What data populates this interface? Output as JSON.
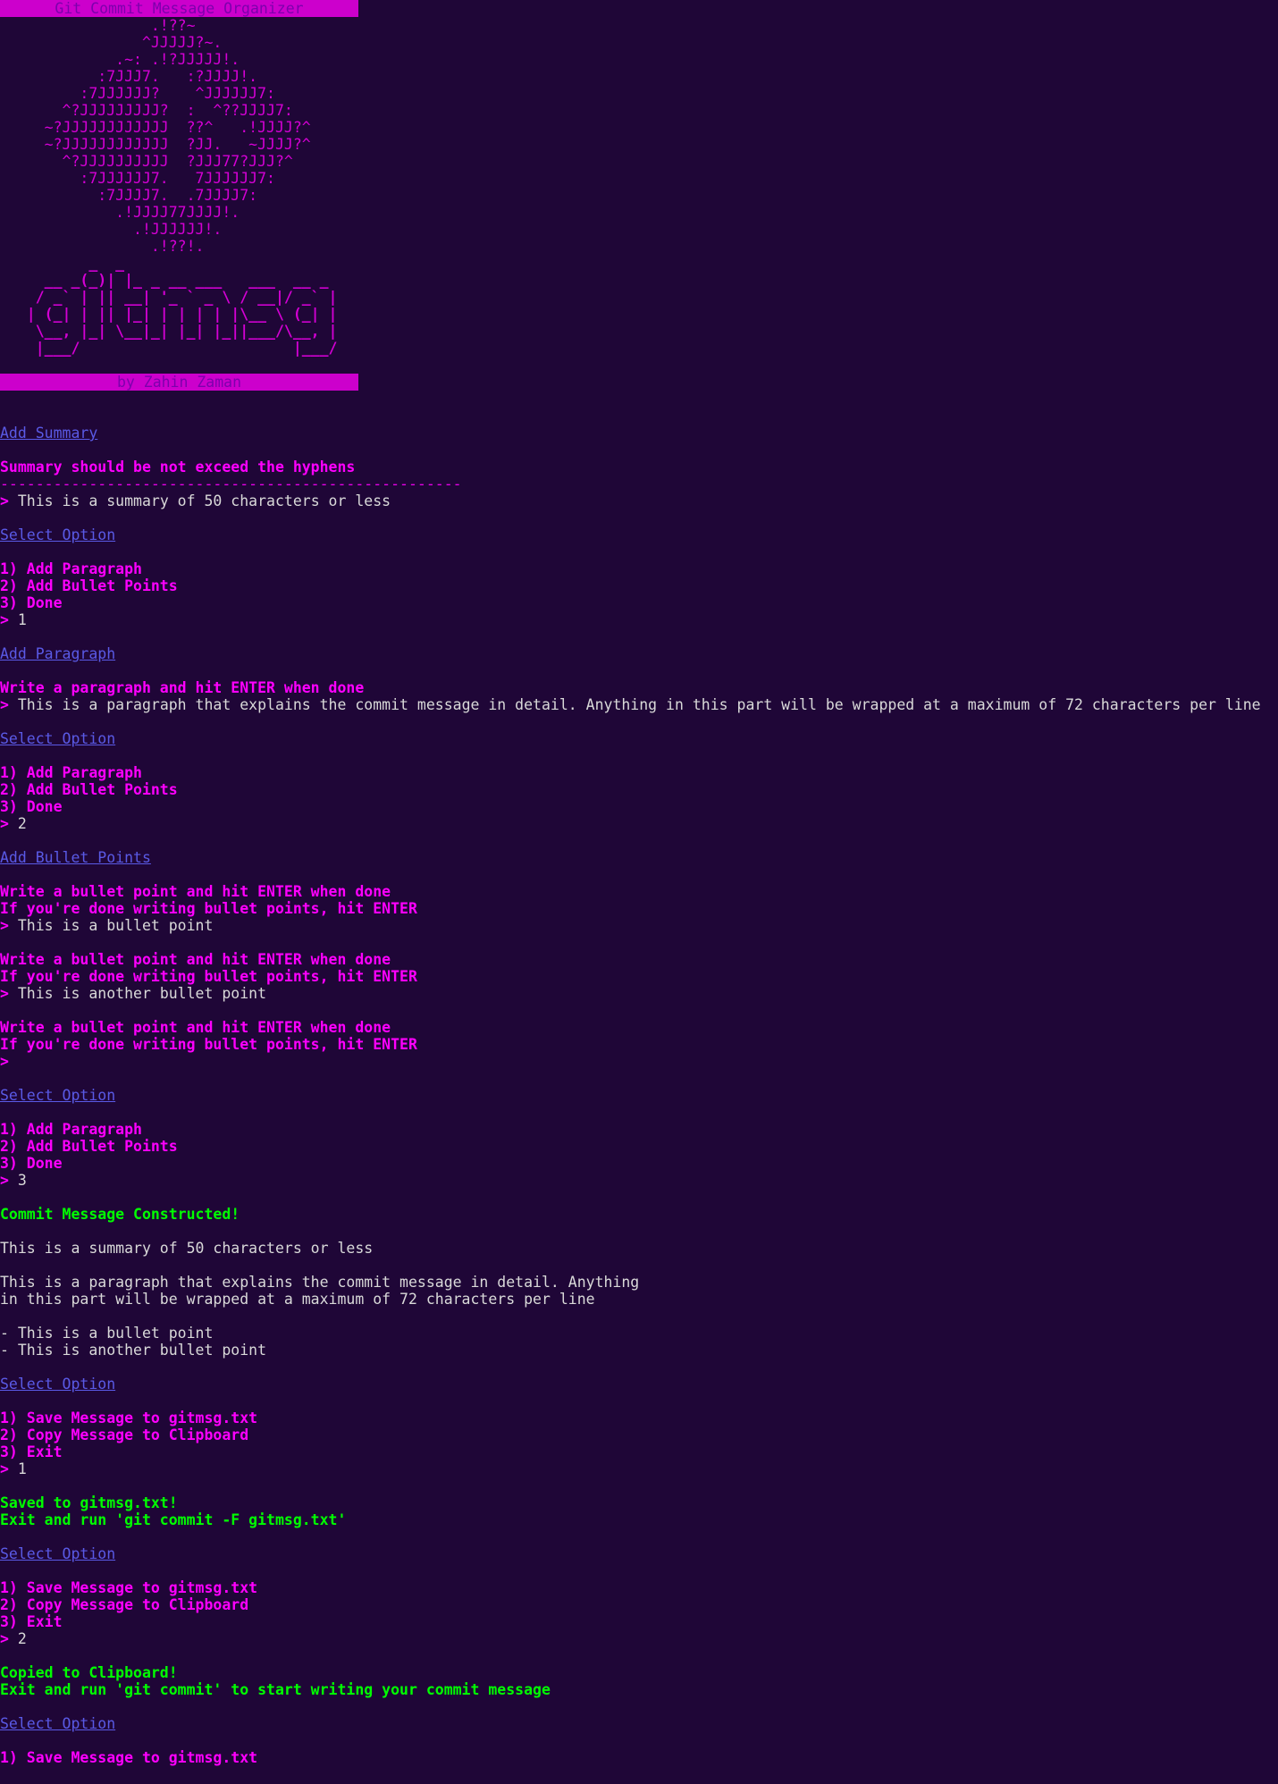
{
  "banner_title": "Git Commit Message Organizer",
  "ascii_art": [
    "                 .!??~",
    "                ^JJJJJ?~.",
    "             .~: .!?JJJJJ!.",
    "           :7JJJ7.   :?JJJJ!.",
    "         :7JJJJJJ?    ^JJJJJJ7:",
    "       ^?JJJJJJJJJ?  :  ^??JJJJ7:",
    "     ~?JJJJJJJJJJJJ  ??^   .!JJJJ?^",
    "     ~?JJJJJJJJJJJJ  ?JJ.   ~JJJJ?^",
    "       ^?JJJJJJJJJJ  ?JJJ77?JJJ?^",
    "         :7JJJJJJ7.   7JJJJJJ7:",
    "           :7JJJJ7.  .7JJJJ7:",
    "             .!JJJJ77JJJJ!.",
    "               .!JJJJJJ!.",
    "                 .!??!."
  ],
  "logo_art": [
    "          _  _",
    "     __ _(_)| |_ _ __ ___   ___  __ _",
    "    / _` | || __| '_ ` _ \\ / __|/ _` |",
    "   | (_| | || |_| | | | | |\\__ \\ (_| |",
    "    \\__, |_| \\__|_| |_| |_||___/\\__, |",
    "    |___/                        |___/"
  ],
  "author_banner": "by Zahin Zaman",
  "prompt_symbol": ">",
  "headings": {
    "add_summary": "Add Summary",
    "select_option": "Select Option",
    "add_paragraph": "Add Paragraph",
    "add_bullet_points": "Add Bullet Points"
  },
  "messages": {
    "summary_hint": "Summary should be not exceed the hyphens",
    "hyphens": "----------------------------------------------------",
    "paragraph_hint": "Write a paragraph and hit ENTER when done",
    "bullet_hint": "Write a bullet point and hit ENTER when done",
    "bullet_done_hint": "If you're done writing bullet points, hit ENTER"
  },
  "menu_compose": [
    "1) Add Paragraph",
    "2) Add Bullet Points",
    "3) Done"
  ],
  "menu_output": [
    "1) Save Message to gitmsg.txt",
    "2) Copy Message to Clipboard",
    "3) Exit"
  ],
  "inputs": {
    "summary": "This is a summary of 50 characters or less",
    "choice_1": "1",
    "paragraph": "This is a paragraph that explains the commit message in detail. Anything in this part will be wrapped at a maximum of 72 characters per line",
    "choice_2": "2",
    "bullet_1": "This is a bullet point",
    "bullet_2": "This is another bullet point",
    "bullet_3": "",
    "choice_3": "3",
    "choice_save": "1",
    "choice_copy": "2"
  },
  "result": {
    "constructed_title": "Commit Message Constructed!",
    "summary": "This is a summary of 50 characters or less",
    "paragraph_lines": [
      "This is a paragraph that explains the commit message in detail. Anything",
      "in this part will be wrapped at a maximum of 72 characters per line"
    ],
    "bullets": [
      "- This is a bullet point",
      "- This is another bullet point"
    ]
  },
  "status": {
    "saved": "Saved to gitmsg.txt!",
    "saved_hint": "Exit and run 'git commit -F gitmsg.txt'",
    "copied": "Copied to Clipboard!",
    "copied_hint": "Exit and run 'git commit' to start writing your commit message"
  },
  "colors": {
    "background": "#1f0637",
    "magenta": "#ff00ff",
    "heading_blue": "#5a5ae6",
    "success_green": "#00ff00",
    "banner_bg": "#cc00cc",
    "banner_text": "#7d00ad",
    "input_text": "#d9d9d9"
  }
}
